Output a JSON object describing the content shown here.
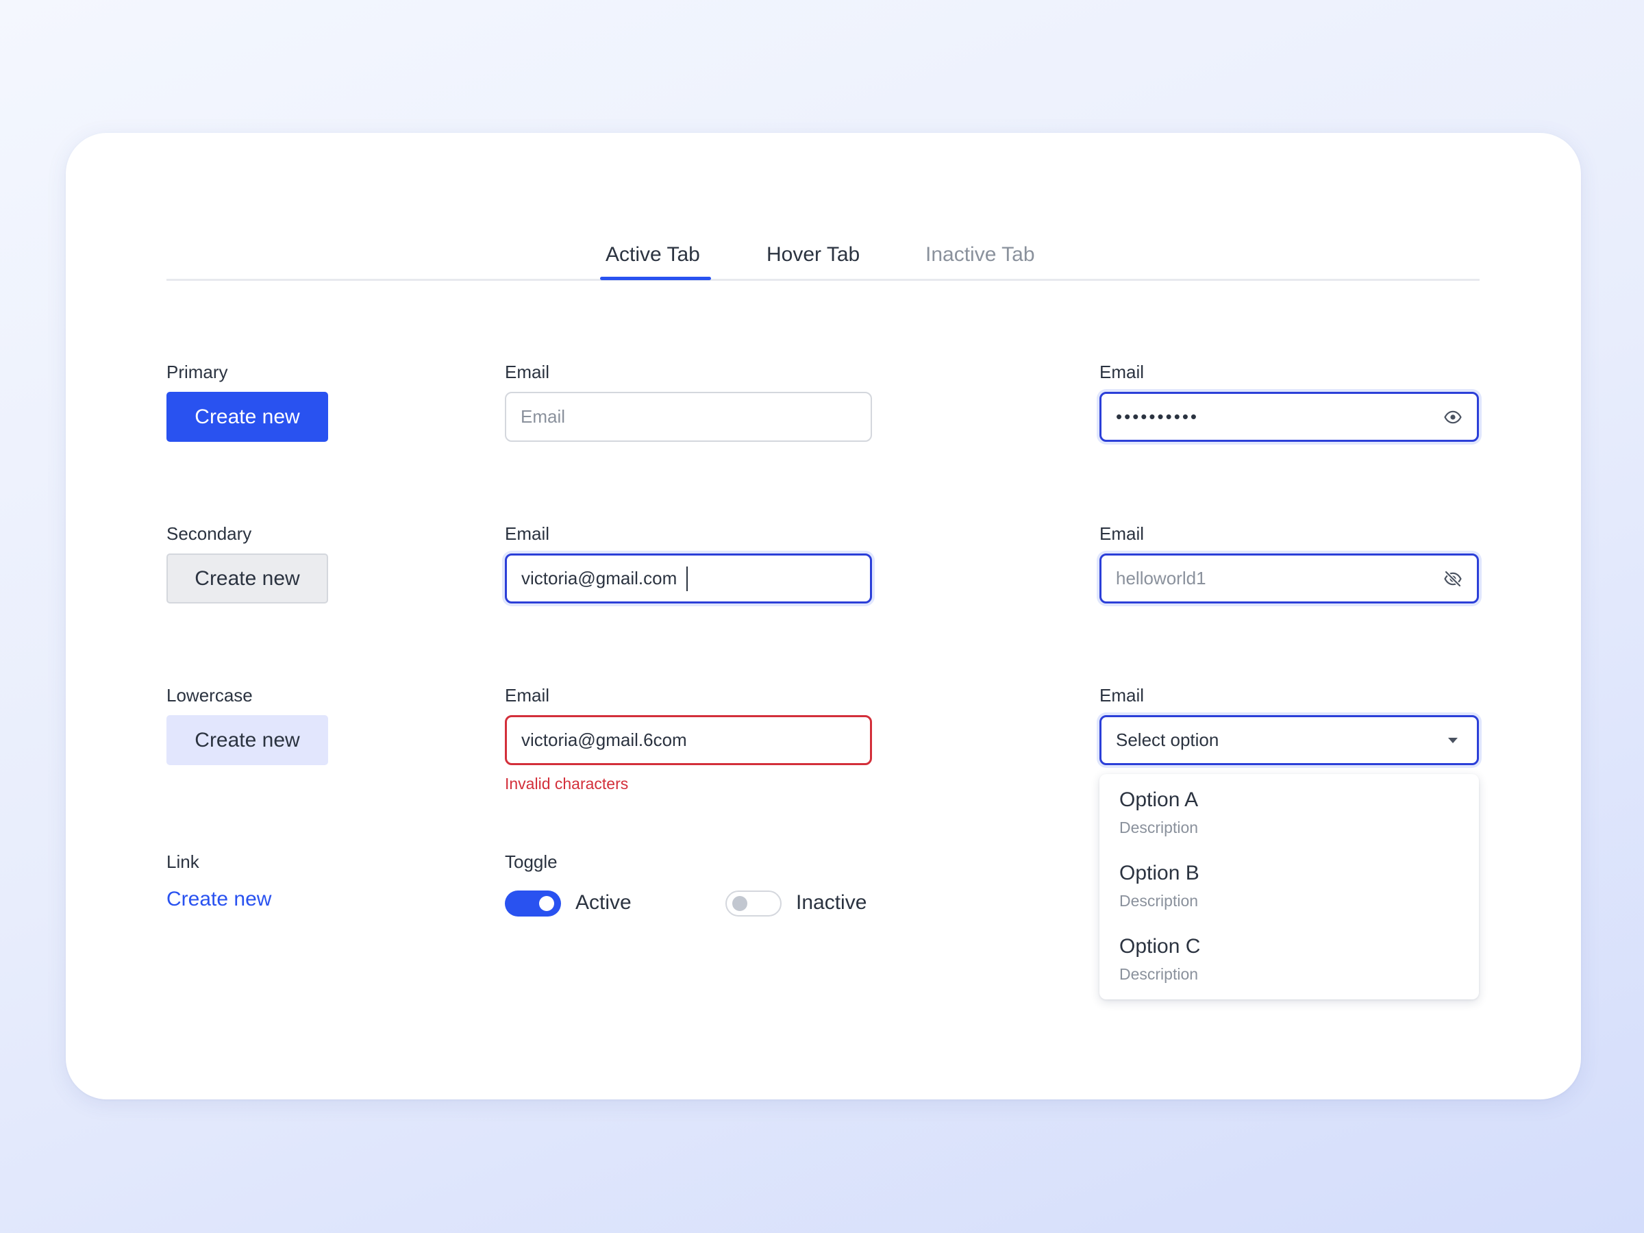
{
  "tabs": [
    {
      "label": "Active Tab",
      "state": "active"
    },
    {
      "label": "Hover Tab",
      "state": "hover"
    },
    {
      "label": "Inactive Tab",
      "state": "inactive"
    }
  ],
  "buttons": {
    "primary": {
      "section_label": "Primary",
      "label": "Create new"
    },
    "secondary": {
      "section_label": "Secondary",
      "label": "Create new"
    },
    "lowercase": {
      "section_label": "Lowercase",
      "label": "Create new"
    },
    "link": {
      "section_label": "Link",
      "label": "Create new"
    }
  },
  "email_fields": {
    "default": {
      "label": "Email",
      "placeholder": "Email"
    },
    "focused": {
      "label": "Email",
      "value": "victoria@gmail.com"
    },
    "error": {
      "label": "Email",
      "value": "victoria@gmail.6com",
      "error": "Invalid characters"
    }
  },
  "password_fields": {
    "hidden": {
      "label": "Email",
      "value": "••••••••••",
      "icon": "eye-icon"
    },
    "shown": {
      "label": "Email",
      "value": "helloworld1",
      "icon": "eye-off-icon"
    }
  },
  "select": {
    "label": "Email",
    "value": "Select option",
    "icon": "caret-down-icon",
    "options": [
      {
        "title": "Option A",
        "description": "Description"
      },
      {
        "title": "Option B",
        "description": "Description"
      },
      {
        "title": "Option C",
        "description": "Description"
      }
    ]
  },
  "toggle": {
    "label": "Toggle",
    "active": {
      "label": "Active",
      "on": true
    },
    "inactive": {
      "label": "Inactive",
      "on": false
    }
  },
  "colors": {
    "primary": "#2952f0",
    "focus_border": "#2b3fd8",
    "error": "#d32f3a",
    "secondary_bg": "#ebecef",
    "lowercase_bg": "#e2e6fd",
    "muted_text": "#8a919c",
    "text": "#2b3340"
  }
}
